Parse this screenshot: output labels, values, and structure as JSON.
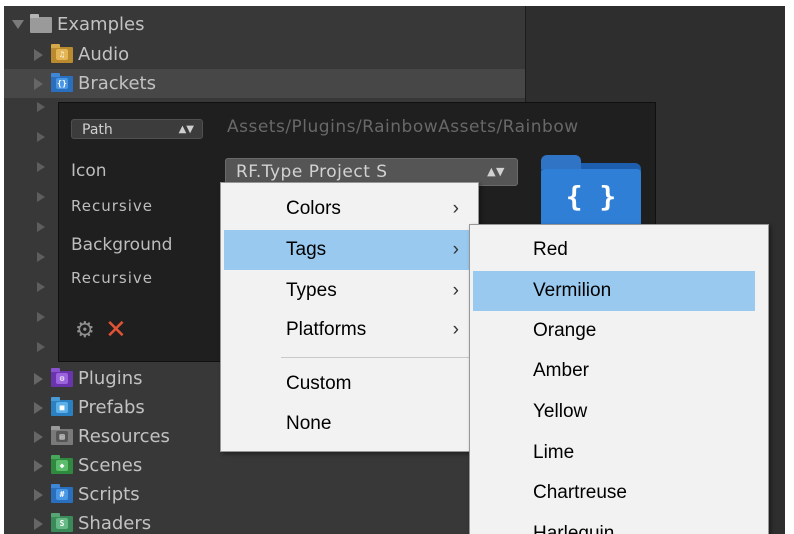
{
  "tree": {
    "root": {
      "label": "Examples"
    },
    "items": [
      {
        "label": "Audio",
        "color": "#c89a3a",
        "glyph": "♫"
      },
      {
        "label": "Brackets",
        "color": "#2f7fd6",
        "glyph": "{}"
      },
      {
        "label": "Plugins",
        "color": "#7a3fc0",
        "glyph": "⚙"
      },
      {
        "label": "Prefabs",
        "color": "#2f8fd0",
        "glyph": "■"
      },
      {
        "label": "Resources",
        "color": "#8a8a8a",
        "glyph": "▤"
      },
      {
        "label": "Scenes",
        "color": "#3a9a4a",
        "glyph": "◆"
      },
      {
        "label": "Scripts",
        "color": "#2f7fd6",
        "glyph": "#"
      },
      {
        "label": "Shaders",
        "color": "#4a9a6a",
        "glyph": "S"
      }
    ]
  },
  "panel": {
    "path_select": "Path",
    "path_value": "Assets/Plugins/RainbowAssets/Rainbow",
    "icon_label": "Icon",
    "icon_value": "RF.Type Project S",
    "recursive_label_1": "Recursive",
    "background_label": "Background",
    "recursive_label_2": "Recursive",
    "preview_glyph": "{ }"
  },
  "menu": {
    "items": [
      {
        "label": "Colors",
        "submenu": "›"
      },
      {
        "label": "Tags",
        "submenu": "›"
      },
      {
        "label": "Types",
        "submenu": "›"
      },
      {
        "label": "Platforms",
        "submenu": "›"
      },
      {
        "label": "Custom"
      },
      {
        "label": "None"
      }
    ],
    "highlighted": "Tags"
  },
  "submenu": {
    "items": [
      "Red",
      "Vermilion",
      "Orange",
      "Amber",
      "Yellow",
      "Lime",
      "Chartreuse",
      "Harlequin"
    ],
    "highlighted": "Vermilion"
  },
  "colors": {
    "highlight": "#99c9ef",
    "remove": "#e05234",
    "folder": "#2f7fd6"
  }
}
